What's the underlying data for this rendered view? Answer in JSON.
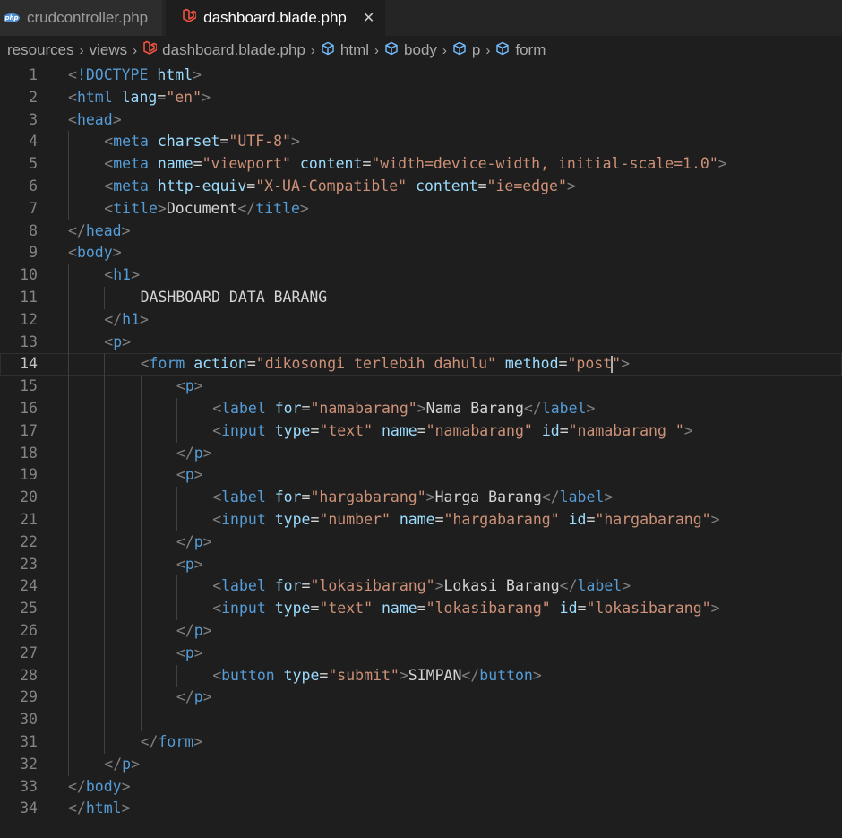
{
  "tabs": [
    {
      "label": "crudcontroller.php",
      "icon": "php-icon",
      "active": false
    },
    {
      "label": "dashboard.blade.php",
      "icon": "laravel-icon",
      "active": true
    }
  ],
  "breadcrumb": [
    {
      "label": "resources",
      "icon": ""
    },
    {
      "label": "views",
      "icon": ""
    },
    {
      "label": "dashboard.blade.php",
      "icon": "laravel-icon"
    },
    {
      "label": "html",
      "icon": "cube-icon"
    },
    {
      "label": "body",
      "icon": "cube-icon"
    },
    {
      "label": "p",
      "icon": "cube-icon"
    },
    {
      "label": "form",
      "icon": "cube-icon"
    }
  ],
  "editor": {
    "current_line": 14,
    "lines": [
      {
        "n": "1",
        "indent": 0,
        "tokens": [
          [
            "p",
            "<"
          ],
          [
            "t",
            "!DOCTYPE"
          ],
          [
            "x",
            " "
          ],
          [
            "a",
            "html"
          ],
          [
            "p",
            ">"
          ]
        ]
      },
      {
        "n": "2",
        "indent": 0,
        "tokens": [
          [
            "p",
            "<"
          ],
          [
            "t",
            "html"
          ],
          [
            "x",
            " "
          ],
          [
            "a",
            "lang"
          ],
          [
            "x",
            "="
          ],
          [
            "s",
            "\"en\""
          ],
          [
            "p",
            ">"
          ]
        ]
      },
      {
        "n": "3",
        "indent": 0,
        "tokens": [
          [
            "p",
            "<"
          ],
          [
            "t",
            "head"
          ],
          [
            "p",
            ">"
          ]
        ]
      },
      {
        "n": "4",
        "indent": 1,
        "tokens": [
          [
            "p",
            "<"
          ],
          [
            "t",
            "meta"
          ],
          [
            "x",
            " "
          ],
          [
            "a",
            "charset"
          ],
          [
            "x",
            "="
          ],
          [
            "s",
            "\"UTF-8\""
          ],
          [
            "p",
            ">"
          ]
        ]
      },
      {
        "n": "5",
        "indent": 1,
        "tokens": [
          [
            "p",
            "<"
          ],
          [
            "t",
            "meta"
          ],
          [
            "x",
            " "
          ],
          [
            "a",
            "name"
          ],
          [
            "x",
            "="
          ],
          [
            "s",
            "\"viewport\""
          ],
          [
            "x",
            " "
          ],
          [
            "a",
            "content"
          ],
          [
            "x",
            "="
          ],
          [
            "s",
            "\"width=device-width, initial-scale=1.0\""
          ],
          [
            "p",
            ">"
          ]
        ]
      },
      {
        "n": "6",
        "indent": 1,
        "tokens": [
          [
            "p",
            "<"
          ],
          [
            "t",
            "meta"
          ],
          [
            "x",
            " "
          ],
          [
            "a",
            "http-equiv"
          ],
          [
            "x",
            "="
          ],
          [
            "s",
            "\"X-UA-Compatible\""
          ],
          [
            "x",
            " "
          ],
          [
            "a",
            "content"
          ],
          [
            "x",
            "="
          ],
          [
            "s",
            "\"ie=edge\""
          ],
          [
            "p",
            ">"
          ]
        ]
      },
      {
        "n": "7",
        "indent": 1,
        "tokens": [
          [
            "p",
            "<"
          ],
          [
            "t",
            "title"
          ],
          [
            "p",
            ">"
          ],
          [
            "x",
            "Document"
          ],
          [
            "p",
            "</"
          ],
          [
            "t",
            "title"
          ],
          [
            "p",
            ">"
          ]
        ]
      },
      {
        "n": "8",
        "indent": 0,
        "tokens": [
          [
            "p",
            "</"
          ],
          [
            "t",
            "head"
          ],
          [
            "p",
            ">"
          ]
        ]
      },
      {
        "n": "9",
        "indent": 0,
        "tokens": [
          [
            "p",
            "<"
          ],
          [
            "t",
            "body"
          ],
          [
            "p",
            ">"
          ]
        ]
      },
      {
        "n": "10",
        "indent": 1,
        "tokens": [
          [
            "p",
            "<"
          ],
          [
            "t",
            "h1"
          ],
          [
            "p",
            ">"
          ]
        ]
      },
      {
        "n": "11",
        "indent": 2,
        "tokens": [
          [
            "x",
            "DASHBOARD DATA BARANG"
          ]
        ]
      },
      {
        "n": "12",
        "indent": 1,
        "tokens": [
          [
            "p",
            "</"
          ],
          [
            "t",
            "h1"
          ],
          [
            "p",
            ">"
          ]
        ]
      },
      {
        "n": "13",
        "indent": 1,
        "tokens": [
          [
            "p",
            "<"
          ],
          [
            "t",
            "p"
          ],
          [
            "p",
            ">"
          ]
        ]
      },
      {
        "n": "14",
        "indent": 2,
        "tokens": [
          [
            "p",
            "<"
          ],
          [
            "t",
            "form"
          ],
          [
            "x",
            " "
          ],
          [
            "a",
            "action"
          ],
          [
            "x",
            "="
          ],
          [
            "s",
            "\"dikosongi terlebih dahulu\""
          ],
          [
            "x",
            " "
          ],
          [
            "a",
            "method"
          ],
          [
            "x",
            "="
          ],
          [
            "s",
            "\"post"
          ],
          [
            "cursor",
            ""
          ],
          [
            "s",
            "\""
          ],
          [
            "p",
            ">"
          ]
        ]
      },
      {
        "n": "15",
        "indent": 3,
        "tokens": [
          [
            "p",
            "<"
          ],
          [
            "t",
            "p"
          ],
          [
            "p",
            ">"
          ]
        ]
      },
      {
        "n": "16",
        "indent": 4,
        "tokens": [
          [
            "p",
            "<"
          ],
          [
            "t",
            "label"
          ],
          [
            "x",
            " "
          ],
          [
            "a",
            "for"
          ],
          [
            "x",
            "="
          ],
          [
            "s",
            "\"namabarang\""
          ],
          [
            "p",
            ">"
          ],
          [
            "x",
            "Nama Barang"
          ],
          [
            "p",
            "</"
          ],
          [
            "t",
            "label"
          ],
          [
            "p",
            ">"
          ]
        ]
      },
      {
        "n": "17",
        "indent": 4,
        "tokens": [
          [
            "p",
            "<"
          ],
          [
            "t",
            "input"
          ],
          [
            "x",
            " "
          ],
          [
            "a",
            "type"
          ],
          [
            "x",
            "="
          ],
          [
            "s",
            "\"text\""
          ],
          [
            "x",
            " "
          ],
          [
            "a",
            "name"
          ],
          [
            "x",
            "="
          ],
          [
            "s",
            "\"namabarang\""
          ],
          [
            "x",
            " "
          ],
          [
            "a",
            "id"
          ],
          [
            "x",
            "="
          ],
          [
            "s",
            "\"namabarang \""
          ],
          [
            "p",
            ">"
          ]
        ]
      },
      {
        "n": "18",
        "indent": 3,
        "tokens": [
          [
            "p",
            "</"
          ],
          [
            "t",
            "p"
          ],
          [
            "p",
            ">"
          ]
        ]
      },
      {
        "n": "19",
        "indent": 3,
        "tokens": [
          [
            "p",
            "<"
          ],
          [
            "t",
            "p"
          ],
          [
            "p",
            ">"
          ]
        ]
      },
      {
        "n": "20",
        "indent": 4,
        "tokens": [
          [
            "p",
            "<"
          ],
          [
            "t",
            "label"
          ],
          [
            "x",
            " "
          ],
          [
            "a",
            "for"
          ],
          [
            "x",
            "="
          ],
          [
            "s",
            "\"hargabarang\""
          ],
          [
            "p",
            ">"
          ],
          [
            "x",
            "Harga Barang"
          ],
          [
            "p",
            "</"
          ],
          [
            "t",
            "label"
          ],
          [
            "p",
            ">"
          ]
        ]
      },
      {
        "n": "21",
        "indent": 4,
        "tokens": [
          [
            "p",
            "<"
          ],
          [
            "t",
            "input"
          ],
          [
            "x",
            " "
          ],
          [
            "a",
            "type"
          ],
          [
            "x",
            "="
          ],
          [
            "s",
            "\"number\""
          ],
          [
            "x",
            " "
          ],
          [
            "a",
            "name"
          ],
          [
            "x",
            "="
          ],
          [
            "s",
            "\"hargabarang\""
          ],
          [
            "x",
            " "
          ],
          [
            "a",
            "id"
          ],
          [
            "x",
            "="
          ],
          [
            "s",
            "\"hargabarang\""
          ],
          [
            "p",
            ">"
          ]
        ]
      },
      {
        "n": "22",
        "indent": 3,
        "tokens": [
          [
            "p",
            "</"
          ],
          [
            "t",
            "p"
          ],
          [
            "p",
            ">"
          ]
        ]
      },
      {
        "n": "23",
        "indent": 3,
        "tokens": [
          [
            "p",
            "<"
          ],
          [
            "t",
            "p"
          ],
          [
            "p",
            ">"
          ]
        ]
      },
      {
        "n": "24",
        "indent": 4,
        "tokens": [
          [
            "p",
            "<"
          ],
          [
            "t",
            "label"
          ],
          [
            "x",
            " "
          ],
          [
            "a",
            "for"
          ],
          [
            "x",
            "="
          ],
          [
            "s",
            "\"lokasibarang\""
          ],
          [
            "p",
            ">"
          ],
          [
            "x",
            "Lokasi Barang"
          ],
          [
            "p",
            "</"
          ],
          [
            "t",
            "label"
          ],
          [
            "p",
            ">"
          ]
        ]
      },
      {
        "n": "25",
        "indent": 4,
        "tokens": [
          [
            "p",
            "<"
          ],
          [
            "t",
            "input"
          ],
          [
            "x",
            " "
          ],
          [
            "a",
            "type"
          ],
          [
            "x",
            "="
          ],
          [
            "s",
            "\"text\""
          ],
          [
            "x",
            " "
          ],
          [
            "a",
            "name"
          ],
          [
            "x",
            "="
          ],
          [
            "s",
            "\"lokasibarang\""
          ],
          [
            "x",
            " "
          ],
          [
            "a",
            "id"
          ],
          [
            "x",
            "="
          ],
          [
            "s",
            "\"lokasibarang\""
          ],
          [
            "p",
            ">"
          ]
        ]
      },
      {
        "n": "26",
        "indent": 3,
        "tokens": [
          [
            "p",
            "</"
          ],
          [
            "t",
            "p"
          ],
          [
            "p",
            ">"
          ]
        ]
      },
      {
        "n": "27",
        "indent": 3,
        "tokens": [
          [
            "p",
            "<"
          ],
          [
            "t",
            "p"
          ],
          [
            "p",
            ">"
          ]
        ]
      },
      {
        "n": "28",
        "indent": 4,
        "tokens": [
          [
            "p",
            "<"
          ],
          [
            "t",
            "button"
          ],
          [
            "x",
            " "
          ],
          [
            "a",
            "type"
          ],
          [
            "x",
            "="
          ],
          [
            "s",
            "\"submit\""
          ],
          [
            "p",
            ">"
          ],
          [
            "x",
            "SIMPAN"
          ],
          [
            "p",
            "</"
          ],
          [
            "t",
            "button"
          ],
          [
            "p",
            ">"
          ]
        ]
      },
      {
        "n": "29",
        "indent": 3,
        "tokens": [
          [
            "p",
            "</"
          ],
          [
            "t",
            "p"
          ],
          [
            "p",
            ">"
          ]
        ]
      },
      {
        "n": "30",
        "indent": 3,
        "tokens": []
      },
      {
        "n": "31",
        "indent": 2,
        "tokens": [
          [
            "p",
            "</"
          ],
          [
            "t",
            "form"
          ],
          [
            "p",
            ">"
          ]
        ]
      },
      {
        "n": "32",
        "indent": 1,
        "tokens": [
          [
            "p",
            "</"
          ],
          [
            "t",
            "p"
          ],
          [
            "p",
            ">"
          ]
        ]
      },
      {
        "n": "33",
        "indent": 0,
        "tokens": [
          [
            "p",
            "</"
          ],
          [
            "t",
            "body"
          ],
          [
            "p",
            ">"
          ]
        ]
      },
      {
        "n": "34",
        "indent": 0,
        "tokens": [
          [
            "p",
            "</"
          ],
          [
            "t",
            "html"
          ],
          [
            "p",
            ">"
          ]
        ]
      }
    ]
  },
  "colors": {
    "background": "#1e1e1e",
    "tag": "#569cd6",
    "attribute": "#9cdcfe",
    "string": "#ce9178",
    "text": "#d4d4d4",
    "punctuation": "#808080",
    "line_number": "#858585"
  }
}
